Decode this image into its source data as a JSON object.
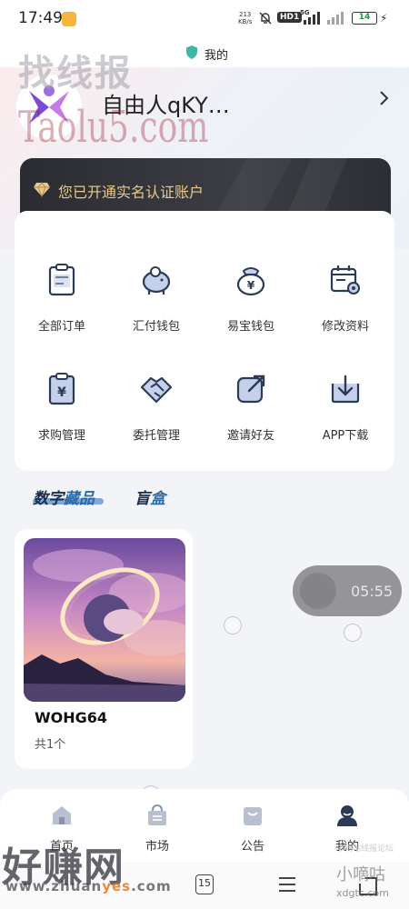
{
  "status_bar": {
    "time": "17:49",
    "net_speed_value": "213",
    "net_speed_unit": "KB/s",
    "hd_badge": "HD1",
    "network": "5G",
    "battery": "14"
  },
  "header": {
    "title": "我的"
  },
  "profile": {
    "username": "自由人qKY…"
  },
  "verification": {
    "text": "您已开通实名认证账户"
  },
  "menu": {
    "items": [
      {
        "label": "全部订单",
        "icon": "order-list-icon"
      },
      {
        "label": "汇付钱包",
        "icon": "piggy-bank-icon"
      },
      {
        "label": "易宝钱包",
        "icon": "yuan-bag-icon"
      },
      {
        "label": "修改资料",
        "icon": "calendar-settings-icon"
      },
      {
        "label": "求购管理",
        "icon": "yuan-clipboard-icon"
      },
      {
        "label": "委托管理",
        "icon": "handshake-icon"
      },
      {
        "label": "邀请好友",
        "icon": "share-icon"
      },
      {
        "label": "APP下载",
        "icon": "download-icon"
      }
    ]
  },
  "tabs": {
    "digital_a": "数字",
    "digital_b": "藏品",
    "blind_a": "盲",
    "blind_b": "盒"
  },
  "collection": {
    "name": "WOHG64",
    "count": "共1个"
  },
  "float_timer": {
    "time": "05:55"
  },
  "bottom_nav": {
    "items": [
      {
        "label": "首页",
        "icon": "home-icon"
      },
      {
        "label": "市场",
        "icon": "market-icon"
      },
      {
        "label": "公告",
        "icon": "notice-icon"
      },
      {
        "label": "我的",
        "icon": "user-icon"
      }
    ]
  },
  "system_nav": {
    "tabs_count": "15"
  },
  "watermarks": {
    "top_cn": "找线报",
    "top_en": "Taolu5.com",
    "bottom_cn": "好赚网",
    "bottom_url_a": "www.zhuan",
    "bottom_url_b": "yes",
    "bottom_url_c": ".com",
    "right_cn": "小嘀咕",
    "right_url": "xdgtc.com",
    "right_small": "小嘀咕线报论坛"
  },
  "colors": {
    "accent_blue": "#2c6aa6",
    "gold": "#e9c98a",
    "dark_card": "#2a2c31",
    "icon_navy": "#2d3a56"
  }
}
